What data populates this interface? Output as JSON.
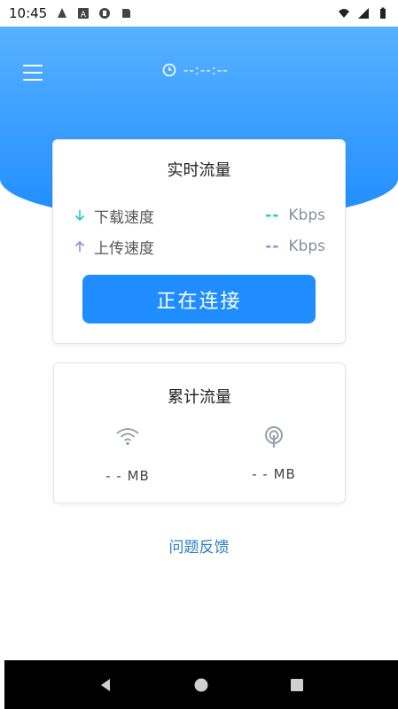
{
  "status_bar": {
    "time": "10:45"
  },
  "header": {
    "timer": "--:--:--"
  },
  "realtime": {
    "title": "实时流量",
    "download_label": "下载速度",
    "download_value": "--",
    "download_unit": "Kbps",
    "upload_label": "上传速度",
    "upload_value": "--",
    "upload_unit": "Kbps",
    "connect_button": "正在连接"
  },
  "total": {
    "title": "累计流量",
    "wifi_value": "- - MB",
    "mobile_value": "- - MB"
  },
  "feedback": "问题反馈",
  "colors": {
    "header_blue": "#1f8dff",
    "download_accent": "#1ec8c8",
    "upload_accent": "#8a8fd8",
    "link": "#2b7fc4"
  }
}
